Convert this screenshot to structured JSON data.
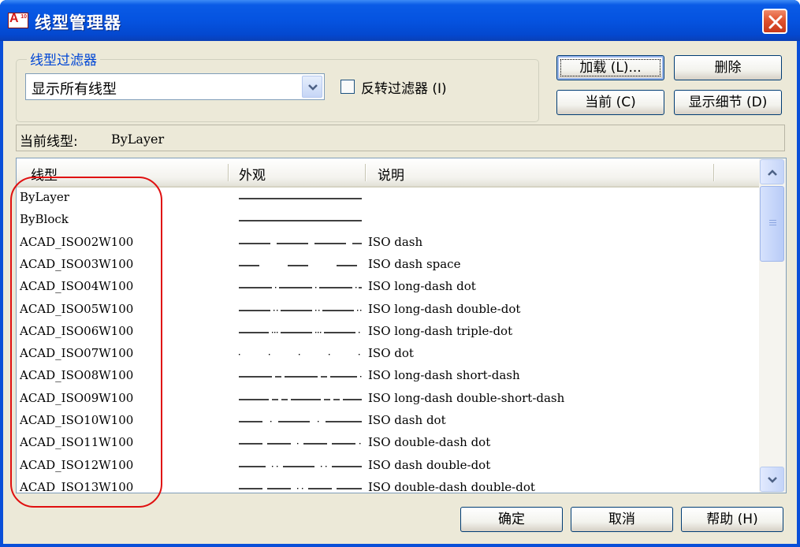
{
  "window": {
    "title": "线型管理器",
    "icon_text": "A",
    "icon_badge": "10"
  },
  "filter": {
    "group_label": "线型过滤器",
    "selected": "显示所有线型",
    "invert_label": "反转过滤器 (I)",
    "invert_checked": false
  },
  "buttons": {
    "load": "加载 (L)...",
    "delete": "删除",
    "current": "当前 (C)",
    "details": "显示细节 (D)",
    "ok": "确定",
    "cancel": "取消",
    "help": "帮助 (H)"
  },
  "current_linetype": {
    "label": "当前线型:",
    "value": "ByLayer"
  },
  "list": {
    "columns": [
      "线型",
      "外观",
      "说明"
    ],
    "rows": [
      {
        "name": "ByLayer",
        "pattern": "solid",
        "desc": ""
      },
      {
        "name": "ByBlock",
        "pattern": "solid",
        "desc": ""
      },
      {
        "name": "ACAD_ISO02W100",
        "pattern": "dash",
        "desc": "ISO dash"
      },
      {
        "name": "ACAD_ISO03W100",
        "pattern": "dash-space",
        "desc": "ISO dash space"
      },
      {
        "name": "ACAD_ISO04W100",
        "pattern": "long-dash-dot",
        "desc": "ISO long-dash dot"
      },
      {
        "name": "ACAD_ISO05W100",
        "pattern": "long-dash-double-dot",
        "desc": "ISO long-dash double-dot"
      },
      {
        "name": "ACAD_ISO06W100",
        "pattern": "long-dash-triple-dot",
        "desc": "ISO long-dash triple-dot"
      },
      {
        "name": "ACAD_ISO07W100",
        "pattern": "dot",
        "desc": "ISO dot"
      },
      {
        "name": "ACAD_ISO08W100",
        "pattern": "long-dash-short-dash",
        "desc": "ISO long-dash short-dash"
      },
      {
        "name": "ACAD_ISO09W100",
        "pattern": "long-dash-double-short-dash",
        "desc": "ISO long-dash double-short-dash"
      },
      {
        "name": "ACAD_ISO10W100",
        "pattern": "dash-dot",
        "desc": "ISO dash dot"
      },
      {
        "name": "ACAD_ISO11W100",
        "pattern": "double-dash-dot",
        "desc": "ISO double-dash dot"
      },
      {
        "name": "ACAD_ISO12W100",
        "pattern": "dash-double-dot",
        "desc": "ISO dash double-dot"
      },
      {
        "name": "ACAD_ISO13W100",
        "pattern": "double-dash-double-dot",
        "desc": "ISO double-dash double-dot"
      }
    ]
  },
  "icons": {
    "app": "autocad-icon",
    "close": "close-icon",
    "combo": "chevron-down-icon",
    "scroll_up": "arrow-up-icon",
    "scroll_down": "arrow-down-icon"
  },
  "colors": {
    "titlebar": "#0553e0",
    "face": "#ece9d8",
    "group_label": "#0046d5",
    "annotation": "#e01010",
    "close": "#e0532f"
  }
}
